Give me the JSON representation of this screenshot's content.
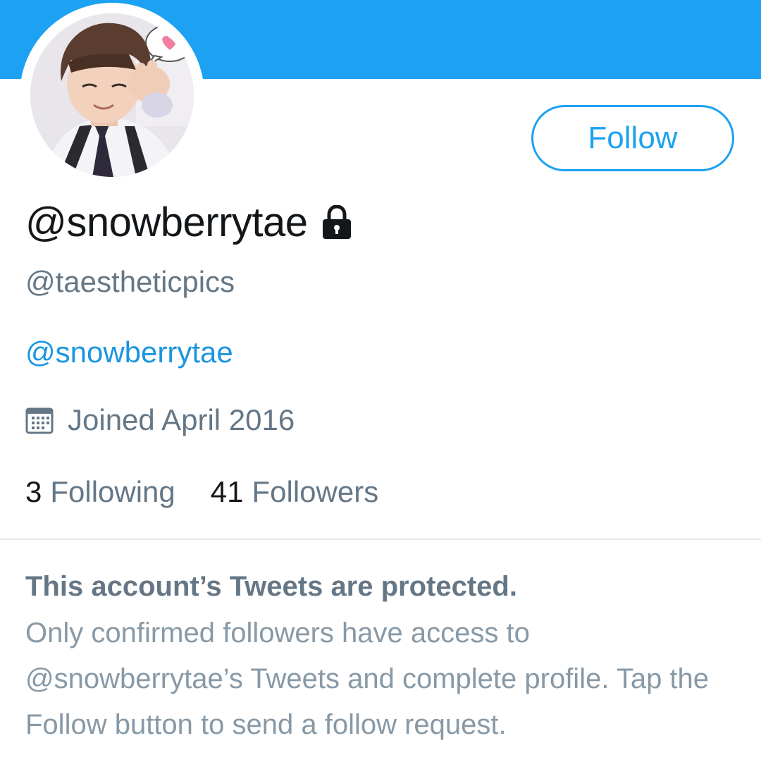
{
  "header": {
    "banner_color": "#1da1f2"
  },
  "profile": {
    "avatar_icon": "profile-photo",
    "follow_button_label": "Follow",
    "display_name": "@snowberrytae",
    "lock_icon": "lock-icon",
    "handle": "@taestheticpics",
    "bio_link": "@snowberrytae",
    "calendar_icon": "calendar-icon",
    "joined": "Joined April 2016",
    "stats": {
      "following_count": "3",
      "following_label": "Following",
      "followers_count": "41",
      "followers_label": "Followers"
    }
  },
  "protected_notice": {
    "title": "This account’s Tweets are protected.",
    "body": "Only confirmed followers have access to @snowberrytae’s Tweets and complete profile. Tap the Follow button to send a follow request."
  },
  "colors": {
    "accent": "#1da1f2",
    "link": "#1b95e0",
    "primary_text": "#14171a",
    "secondary_text": "#657786",
    "divider": "#e1e8ed"
  }
}
